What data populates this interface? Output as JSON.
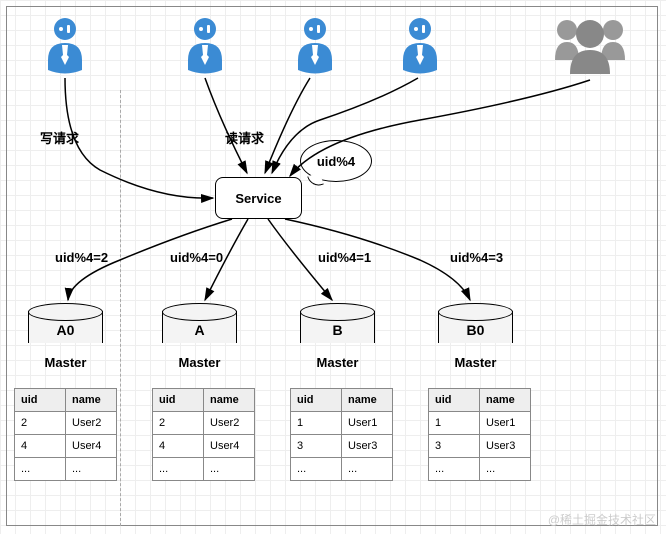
{
  "labels": {
    "write_request": "写请求",
    "read_request": "读请求",
    "service": "Service",
    "bubble": "uid%4"
  },
  "routes": {
    "r0": "uid%4=2",
    "r1": "uid%4=0",
    "r2": "uid%4=1",
    "r3": "uid%4=3"
  },
  "dbs": [
    {
      "name": "A0",
      "role": "Master"
    },
    {
      "name": "A",
      "role": "Master"
    },
    {
      "name": "B",
      "role": "Master"
    },
    {
      "name": "B0",
      "role": "Master"
    }
  ],
  "table_headers": {
    "uid": "uid",
    "name": "name"
  },
  "tables": [
    {
      "rows": [
        {
          "uid": "2",
          "name": "User2"
        },
        {
          "uid": "4",
          "name": "User4"
        },
        {
          "uid": "...",
          "name": "..."
        }
      ]
    },
    {
      "rows": [
        {
          "uid": "2",
          "name": "User2"
        },
        {
          "uid": "4",
          "name": "User4"
        },
        {
          "uid": "...",
          "name": "..."
        }
      ]
    },
    {
      "rows": [
        {
          "uid": "1",
          "name": "User1"
        },
        {
          "uid": "3",
          "name": "User3"
        },
        {
          "uid": "...",
          "name": "..."
        }
      ]
    },
    {
      "rows": [
        {
          "uid": "1",
          "name": "User1"
        },
        {
          "uid": "3",
          "name": "User3"
        },
        {
          "uid": "...",
          "name": "..."
        }
      ]
    }
  ],
  "watermark": "@稀土掘金技术社区",
  "chart_data": {
    "type": "table",
    "title": "Database sharding by uid%4",
    "shards": [
      {
        "label": "A0",
        "role": "Master",
        "rule": "uid%4=2",
        "rows": [
          {
            "uid": 2,
            "name": "User2"
          },
          {
            "uid": 4,
            "name": "User4"
          }
        ]
      },
      {
        "label": "A",
        "role": "Master",
        "rule": "uid%4=0",
        "rows": [
          {
            "uid": 2,
            "name": "User2"
          },
          {
            "uid": 4,
            "name": "User4"
          }
        ]
      },
      {
        "label": "B",
        "role": "Master",
        "rule": "uid%4=1",
        "rows": [
          {
            "uid": 1,
            "name": "User1"
          },
          {
            "uid": 3,
            "name": "User3"
          }
        ]
      },
      {
        "label": "B0",
        "role": "Master",
        "rule": "uid%4=3",
        "rows": [
          {
            "uid": 1,
            "name": "User1"
          },
          {
            "uid": 3,
            "name": "User3"
          }
        ]
      }
    ]
  }
}
